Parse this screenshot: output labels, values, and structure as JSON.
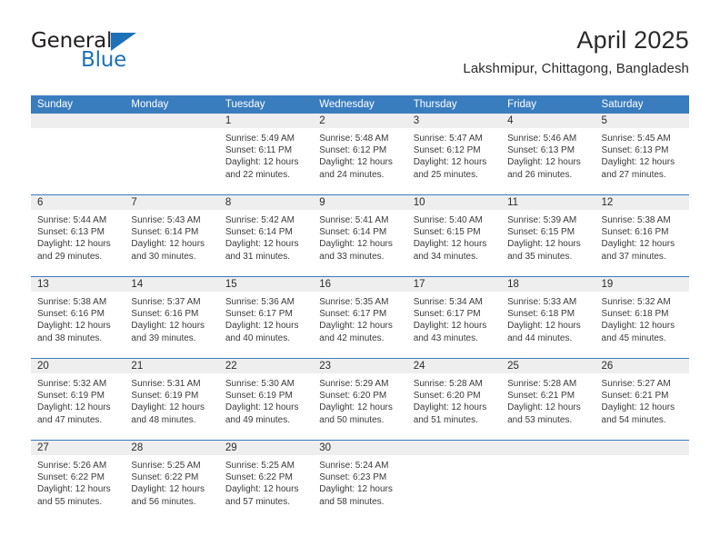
{
  "brand": {
    "name_top": "General",
    "name_bottom": "Blue",
    "accent_color": "#1d71b8"
  },
  "header": {
    "title": "April 2025",
    "subtitle": "Lakshmipur, Chittagong, Bangladesh"
  },
  "theme": {
    "header_blue": "#3a7dbf",
    "daynum_gray": "#eeeeee",
    "text": "#2b2b2b"
  },
  "weekdays": [
    "Sunday",
    "Monday",
    "Tuesday",
    "Wednesday",
    "Thursday",
    "Friday",
    "Saturday"
  ],
  "labels": {
    "sunrise": "Sunrise:",
    "sunset": "Sunset:",
    "daylight": "Daylight:"
  },
  "weeks": [
    [
      {
        "day": "",
        "blank": true
      },
      {
        "day": "",
        "blank": true
      },
      {
        "day": "1",
        "sunrise": "Sunrise: 5:49 AM",
        "sunset": "Sunset: 6:11 PM",
        "daylight_1": "Daylight: 12 hours",
        "daylight_2": "and 22 minutes."
      },
      {
        "day": "2",
        "sunrise": "Sunrise: 5:48 AM",
        "sunset": "Sunset: 6:12 PM",
        "daylight_1": "Daylight: 12 hours",
        "daylight_2": "and 24 minutes."
      },
      {
        "day": "3",
        "sunrise": "Sunrise: 5:47 AM",
        "sunset": "Sunset: 6:12 PM",
        "daylight_1": "Daylight: 12 hours",
        "daylight_2": "and 25 minutes."
      },
      {
        "day": "4",
        "sunrise": "Sunrise: 5:46 AM",
        "sunset": "Sunset: 6:13 PM",
        "daylight_1": "Daylight: 12 hours",
        "daylight_2": "and 26 minutes."
      },
      {
        "day": "5",
        "sunrise": "Sunrise: 5:45 AM",
        "sunset": "Sunset: 6:13 PM",
        "daylight_1": "Daylight: 12 hours",
        "daylight_2": "and 27 minutes."
      }
    ],
    [
      {
        "day": "6",
        "sunrise": "Sunrise: 5:44 AM",
        "sunset": "Sunset: 6:13 PM",
        "daylight_1": "Daylight: 12 hours",
        "daylight_2": "and 29 minutes."
      },
      {
        "day": "7",
        "sunrise": "Sunrise: 5:43 AM",
        "sunset": "Sunset: 6:14 PM",
        "daylight_1": "Daylight: 12 hours",
        "daylight_2": "and 30 minutes."
      },
      {
        "day": "8",
        "sunrise": "Sunrise: 5:42 AM",
        "sunset": "Sunset: 6:14 PM",
        "daylight_1": "Daylight: 12 hours",
        "daylight_2": "and 31 minutes."
      },
      {
        "day": "9",
        "sunrise": "Sunrise: 5:41 AM",
        "sunset": "Sunset: 6:14 PM",
        "daylight_1": "Daylight: 12 hours",
        "daylight_2": "and 33 minutes."
      },
      {
        "day": "10",
        "sunrise": "Sunrise: 5:40 AM",
        "sunset": "Sunset: 6:15 PM",
        "daylight_1": "Daylight: 12 hours",
        "daylight_2": "and 34 minutes."
      },
      {
        "day": "11",
        "sunrise": "Sunrise: 5:39 AM",
        "sunset": "Sunset: 6:15 PM",
        "daylight_1": "Daylight: 12 hours",
        "daylight_2": "and 35 minutes."
      },
      {
        "day": "12",
        "sunrise": "Sunrise: 5:38 AM",
        "sunset": "Sunset: 6:16 PM",
        "daylight_1": "Daylight: 12 hours",
        "daylight_2": "and 37 minutes."
      }
    ],
    [
      {
        "day": "13",
        "sunrise": "Sunrise: 5:38 AM",
        "sunset": "Sunset: 6:16 PM",
        "daylight_1": "Daylight: 12 hours",
        "daylight_2": "and 38 minutes."
      },
      {
        "day": "14",
        "sunrise": "Sunrise: 5:37 AM",
        "sunset": "Sunset: 6:16 PM",
        "daylight_1": "Daylight: 12 hours",
        "daylight_2": "and 39 minutes."
      },
      {
        "day": "15",
        "sunrise": "Sunrise: 5:36 AM",
        "sunset": "Sunset: 6:17 PM",
        "daylight_1": "Daylight: 12 hours",
        "daylight_2": "and 40 minutes."
      },
      {
        "day": "16",
        "sunrise": "Sunrise: 5:35 AM",
        "sunset": "Sunset: 6:17 PM",
        "daylight_1": "Daylight: 12 hours",
        "daylight_2": "and 42 minutes."
      },
      {
        "day": "17",
        "sunrise": "Sunrise: 5:34 AM",
        "sunset": "Sunset: 6:17 PM",
        "daylight_1": "Daylight: 12 hours",
        "daylight_2": "and 43 minutes."
      },
      {
        "day": "18",
        "sunrise": "Sunrise: 5:33 AM",
        "sunset": "Sunset: 6:18 PM",
        "daylight_1": "Daylight: 12 hours",
        "daylight_2": "and 44 minutes."
      },
      {
        "day": "19",
        "sunrise": "Sunrise: 5:32 AM",
        "sunset": "Sunset: 6:18 PM",
        "daylight_1": "Daylight: 12 hours",
        "daylight_2": "and 45 minutes."
      }
    ],
    [
      {
        "day": "20",
        "sunrise": "Sunrise: 5:32 AM",
        "sunset": "Sunset: 6:19 PM",
        "daylight_1": "Daylight: 12 hours",
        "daylight_2": "and 47 minutes."
      },
      {
        "day": "21",
        "sunrise": "Sunrise: 5:31 AM",
        "sunset": "Sunset: 6:19 PM",
        "daylight_1": "Daylight: 12 hours",
        "daylight_2": "and 48 minutes."
      },
      {
        "day": "22",
        "sunrise": "Sunrise: 5:30 AM",
        "sunset": "Sunset: 6:19 PM",
        "daylight_1": "Daylight: 12 hours",
        "daylight_2": "and 49 minutes."
      },
      {
        "day": "23",
        "sunrise": "Sunrise: 5:29 AM",
        "sunset": "Sunset: 6:20 PM",
        "daylight_1": "Daylight: 12 hours",
        "daylight_2": "and 50 minutes."
      },
      {
        "day": "24",
        "sunrise": "Sunrise: 5:28 AM",
        "sunset": "Sunset: 6:20 PM",
        "daylight_1": "Daylight: 12 hours",
        "daylight_2": "and 51 minutes."
      },
      {
        "day": "25",
        "sunrise": "Sunrise: 5:28 AM",
        "sunset": "Sunset: 6:21 PM",
        "daylight_1": "Daylight: 12 hours",
        "daylight_2": "and 53 minutes."
      },
      {
        "day": "26",
        "sunrise": "Sunrise: 5:27 AM",
        "sunset": "Sunset: 6:21 PM",
        "daylight_1": "Daylight: 12 hours",
        "daylight_2": "and 54 minutes."
      }
    ],
    [
      {
        "day": "27",
        "sunrise": "Sunrise: 5:26 AM",
        "sunset": "Sunset: 6:22 PM",
        "daylight_1": "Daylight: 12 hours",
        "daylight_2": "and 55 minutes."
      },
      {
        "day": "28",
        "sunrise": "Sunrise: 5:25 AM",
        "sunset": "Sunset: 6:22 PM",
        "daylight_1": "Daylight: 12 hours",
        "daylight_2": "and 56 minutes."
      },
      {
        "day": "29",
        "sunrise": "Sunrise: 5:25 AM",
        "sunset": "Sunset: 6:22 PM",
        "daylight_1": "Daylight: 12 hours",
        "daylight_2": "and 57 minutes."
      },
      {
        "day": "30",
        "sunrise": "Sunrise: 5:24 AM",
        "sunset": "Sunset: 6:23 PM",
        "daylight_1": "Daylight: 12 hours",
        "daylight_2": "and 58 minutes."
      },
      {
        "day": "",
        "blank": true
      },
      {
        "day": "",
        "blank": true
      },
      {
        "day": "",
        "blank": true
      }
    ]
  ]
}
